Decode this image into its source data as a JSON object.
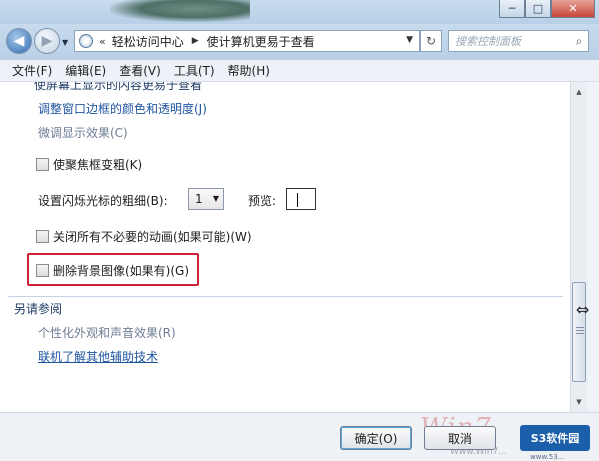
{
  "window": {
    "minimize_glyph": "─",
    "maximize_glyph": "□",
    "close_glyph": "✕"
  },
  "nav": {
    "back_glyph": "◀",
    "forward_glyph": "▶",
    "dropdown_glyph": "▼",
    "breadcrumb_prefix": "«",
    "breadcrumb_arrow": "▶",
    "breadcrumb": [
      "轻松访问中心",
      "使计算机更易于查看"
    ],
    "refresh_glyph": "↻",
    "search_placeholder": "搜索控制面板",
    "search_glyph": "⌕"
  },
  "menubar": {
    "items": [
      "文件(F)",
      "编辑(E)",
      "查看(V)",
      "工具(T)",
      "帮助(H)"
    ]
  },
  "content": {
    "clipped_heading": "使屏幕上显示的内容更易于查看",
    "link_border_color": "调整窗口边框的颜色和透明度(J)",
    "link_fine_tune": "微调显示效果(C)",
    "checkbox_focus": "使聚焦框变粗(K)",
    "cursor_width_label": "设置闪烁光标的粗细(B):",
    "cursor_width_value": "1",
    "preview_label": "预览:",
    "checkbox_animations": "关闭所有不必要的动画(如果可能)(W)",
    "checkbox_background": "删除背景图像(如果有)(G)"
  },
  "see_also": {
    "title": "另请参阅",
    "link_personalize": "个性化外观和声音效果(R)",
    "link_assistive": "联机了解其他辅助技术"
  },
  "buttons": {
    "ok": "确定(O)",
    "cancel": "取消"
  },
  "branding": {
    "watermark": "Win7",
    "watermark_url": "Www.Win7...",
    "logo": "S3软件园",
    "logo_url": "www.53..."
  },
  "colors": {
    "highlight": "#cc2233",
    "link": "#1f55a0"
  }
}
